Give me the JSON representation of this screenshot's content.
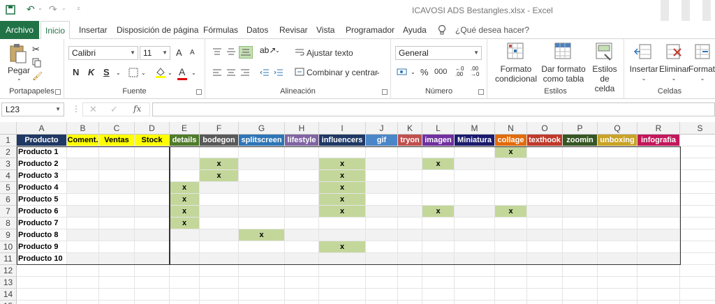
{
  "window": {
    "title": "ICAVOSI ADS Bestangles.xlsx  -  Excel"
  },
  "menu": {
    "tabs": [
      "Archivo",
      "Inicio",
      "Insertar",
      "Disposición de página",
      "Fórmulas",
      "Datos",
      "Revisar",
      "Vista",
      "Programador",
      "Ayuda"
    ],
    "tell_me": "¿Qué desea hacer?"
  },
  "ribbon": {
    "portapapeles": {
      "label": "Portapapeles",
      "paste": "Pegar"
    },
    "fuente": {
      "label": "Fuente",
      "font_name": "Calibri",
      "font_size": "11",
      "grow": "A",
      "shrink": "A",
      "bold": "N",
      "italic": "K",
      "underline": "S",
      "font_color": "A"
    },
    "alineacion": {
      "label": "Alineación",
      "wrap": "Ajustar texto",
      "merge": "Combinar y centrar"
    },
    "numero": {
      "label": "Número",
      "format": "General",
      "percent": "%",
      "thousands": "000"
    },
    "estilos": {
      "label": "Estilos",
      "conditional": "Formato",
      "conditional2": "condicional",
      "as_table": "Dar formato",
      "as_table2": "como tabla",
      "cell_styles": "Estilos de",
      "cell_styles2": "celda"
    },
    "celdas": {
      "label": "Celdas",
      "insert": "Insertar",
      "delete": "Eliminar",
      "format": "Formato"
    }
  },
  "formula_bar": {
    "name_box": "L23",
    "fx": "fx",
    "value": ""
  },
  "sheet": {
    "columns": [
      "A",
      "B",
      "C",
      "D",
      "E",
      "F",
      "G",
      "H",
      "I",
      "J",
      "K",
      "L",
      "M",
      "N",
      "O",
      "P",
      "Q",
      "R",
      "S"
    ],
    "rows": [
      "1",
      "2",
      "3",
      "4",
      "5",
      "6",
      "7",
      "8",
      "9",
      "10",
      "11",
      "12",
      "13",
      "14",
      "15"
    ],
    "headers": [
      {
        "text": "Producto",
        "bg": "#1f3864",
        "fg": "#ffffff"
      },
      {
        "text": "Coment.",
        "bg": "#ffff00",
        "fg": "#000000"
      },
      {
        "text": "Ventas",
        "bg": "#ffff00",
        "fg": "#000000"
      },
      {
        "text": "Stock",
        "bg": "#ffff00",
        "fg": "#000000"
      },
      {
        "text": "details",
        "bg": "#4f7b2a",
        "fg": "#ffffff"
      },
      {
        "text": "bodegon",
        "bg": "#595959",
        "fg": "#ffffff"
      },
      {
        "text": "splitscreen",
        "bg": "#2e75b6",
        "fg": "#ffffff"
      },
      {
        "text": "lifestyle",
        "bg": "#8064a2",
        "fg": "#ffffff"
      },
      {
        "text": "influencers",
        "bg": "#1f3864",
        "fg": "#ffffff"
      },
      {
        "text": "gif",
        "bg": "#4a86c8",
        "fg": "#ffffff"
      },
      {
        "text": "tryon",
        "bg": "#c0504d",
        "fg": "#ffffff"
      },
      {
        "text": "imagen",
        "bg": "#7030a0",
        "fg": "#ffffff"
      },
      {
        "text": "Miniatura",
        "bg": "#1a1a6e",
        "fg": "#ffffff"
      },
      {
        "text": "collage",
        "bg": "#e26b0a",
        "fg": "#ffffff"
      },
      {
        "text": "texthook",
        "bg": "#c0392b",
        "fg": "#ffffff"
      },
      {
        "text": "zoomin",
        "bg": "#375623",
        "fg": "#ffffff"
      },
      {
        "text": "unboxing",
        "bg": "#c9a227",
        "fg": "#ffffff"
      },
      {
        "text": "infografia",
        "bg": "#c2185b",
        "fg": "#ffffff"
      }
    ],
    "products": [
      "Producto 1",
      "Producto 2",
      "Producto 3",
      "Producto 4",
      "Producto 5",
      "Producto 6",
      "Producto 7",
      "Producto 8",
      "Producto 9",
      "Producto 10"
    ],
    "mark": "x",
    "marks": [
      [
        0,
        13
      ],
      [
        1,
        5
      ],
      [
        1,
        8
      ],
      [
        1,
        11
      ],
      [
        2,
        5
      ],
      [
        2,
        8
      ],
      [
        3,
        4
      ],
      [
        3,
        8
      ],
      [
        4,
        4
      ],
      [
        4,
        8
      ],
      [
        5,
        4
      ],
      [
        5,
        8
      ],
      [
        5,
        11
      ],
      [
        5,
        13
      ],
      [
        6,
        4
      ],
      [
        7,
        6
      ],
      [
        8,
        8
      ]
    ]
  }
}
